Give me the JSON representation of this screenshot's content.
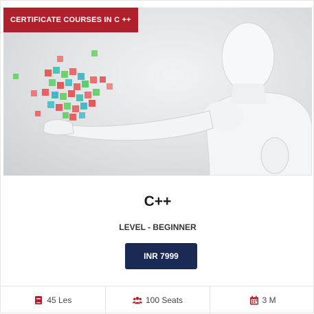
{
  "badge": {
    "text": "CERTIFICATE COURSES IN C ++"
  },
  "course": {
    "title": "C++",
    "level": "LEVEL - BEGINNER",
    "price_label": "INR 7999"
  },
  "stats": [
    {
      "icon": "book-icon",
      "label": "45 Les"
    },
    {
      "icon": "users-icon",
      "label": "100 Seats"
    },
    {
      "icon": "calendar-icon",
      "label": "3 M"
    }
  ],
  "colors": {
    "accent_red": "#b0202c",
    "button_navy": "#1b2a55"
  }
}
